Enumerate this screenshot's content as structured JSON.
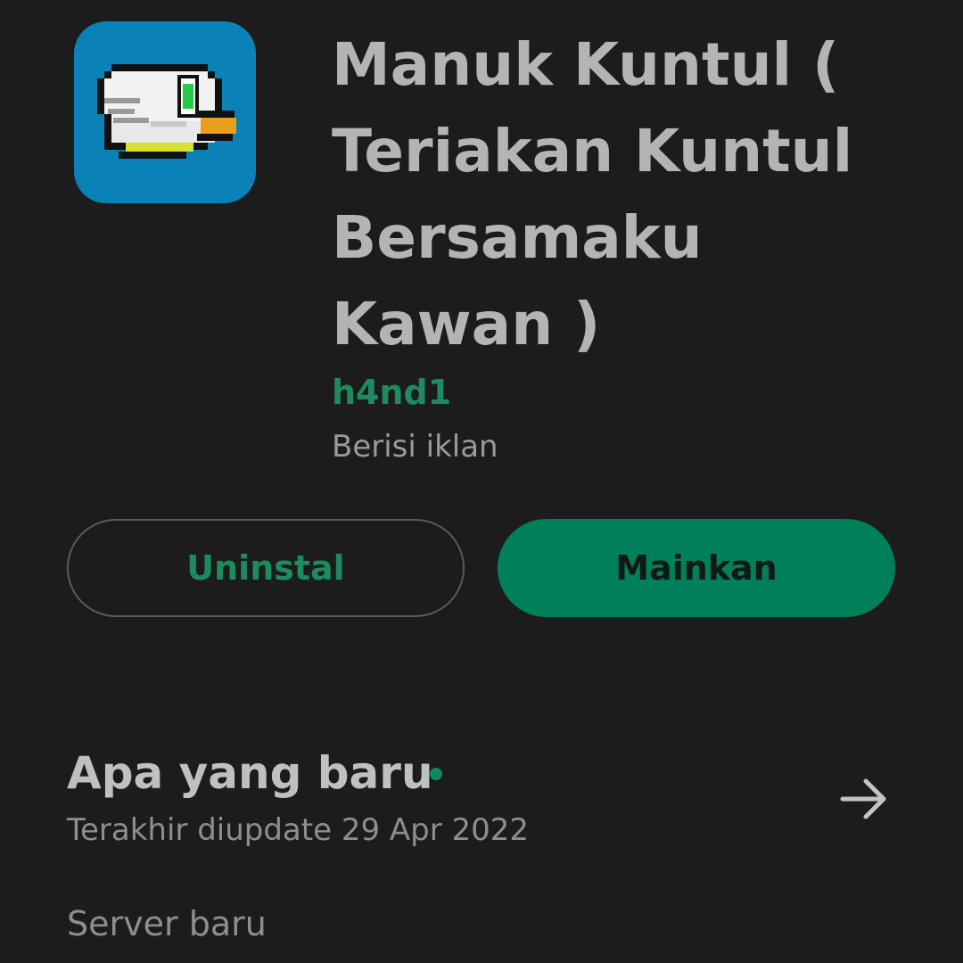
{
  "app": {
    "title": "Manuk Kuntul ( Teriakan Kuntul Bersamaku Kawan )",
    "developer": "h4nd1",
    "ads_note": "Berisi iklan",
    "icon": "pixel-bird-app-icon",
    "icon_bg_color": "#0a82b8"
  },
  "actions": {
    "uninstall_label": "Uninstal",
    "play_label": "Mainkan"
  },
  "whats_new": {
    "title": "Apa yang baru",
    "subtitle": "Terakhir diupdate 29 Apr 2022",
    "notes": "Server baru",
    "arrow_icon": "arrow-right-icon"
  },
  "colors": {
    "background": "#1c1c1c",
    "accent": "#00805a",
    "accent_text": "#1f8a5f"
  }
}
